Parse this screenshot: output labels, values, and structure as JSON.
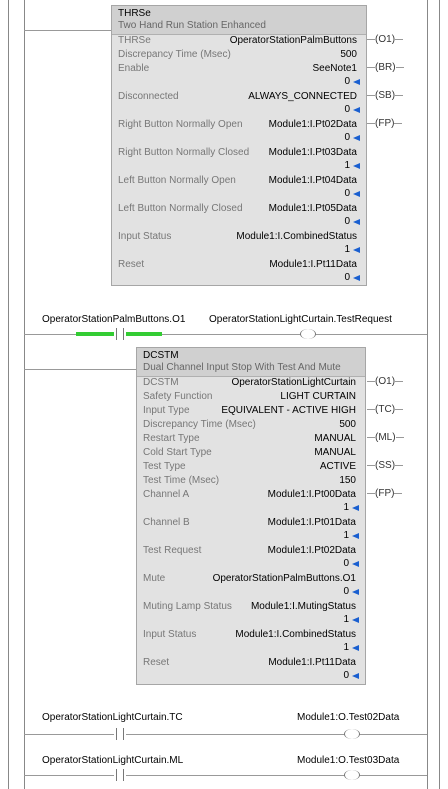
{
  "thrse": {
    "title": "THRSe",
    "subtitle": "Two Hand Run Station Enhanced",
    "rows": [
      {
        "label": "THRSe",
        "value": "OperatorStationPalmButtons"
      },
      {
        "label": "Discrepancy Time (Msec)",
        "value": "500"
      },
      {
        "label": "Enable",
        "value": "SeeNote1"
      },
      {
        "label": "Disconnected",
        "value": "ALWAYS_CONNECTED"
      },
      {
        "label": "Right Button Normally Open",
        "value": "Module1:I.Pt02Data"
      },
      {
        "label": "Right Button Normally Closed",
        "value": "Module1:I.Pt03Data"
      },
      {
        "label": "Left Button Normally Open",
        "value": "Module1:I.Pt04Data"
      },
      {
        "label": "Left Button Normally Closed",
        "value": "Module1:I.Pt05Data"
      },
      {
        "label": "Input Status",
        "value": "Module1:I.CombinedStatus"
      },
      {
        "label": "Reset",
        "value": "Module1:I.Pt11Data"
      }
    ],
    "values": [
      "0",
      "0",
      "0",
      "1",
      "0",
      "0",
      "1",
      "0"
    ],
    "outputs": [
      "O1",
      "BR",
      "SB",
      "FP"
    ]
  },
  "rung2": {
    "contact_tag": "OperatorStationPalmButtons.O1",
    "coil_tag": "OperatorStationLightCurtain.TestRequest"
  },
  "dcstm": {
    "title": "DCSTM",
    "subtitle": "Dual Channel Input Stop With Test And Mute",
    "rows": [
      {
        "label": "DCSTM",
        "value": "OperatorStationLightCurtain"
      },
      {
        "label": "Safety Function",
        "value": "LIGHT CURTAIN"
      },
      {
        "label": "Input Type",
        "value": "EQUIVALENT - ACTIVE HIGH"
      },
      {
        "label": "Discrepancy Time (Msec)",
        "value": "500"
      },
      {
        "label": "Restart Type",
        "value": "MANUAL"
      },
      {
        "label": "Cold Start Type",
        "value": "MANUAL"
      },
      {
        "label": "Test Type",
        "value": "ACTIVE"
      },
      {
        "label": "Test Time (Msec)",
        "value": "150"
      },
      {
        "label": "Channel A",
        "value": "Module1:I.Pt00Data"
      },
      {
        "label": "Channel B",
        "value": "Module1:I.Pt01Data"
      },
      {
        "label": "Test Request",
        "value": "Module1:I.Pt02Data"
      },
      {
        "label": "Mute",
        "value": "OperatorStationPalmButtons.O1"
      },
      {
        "label": "Muting Lamp Status",
        "value": "Module1:I.MutingStatus"
      },
      {
        "label": "Input Status",
        "value": "Module1:I.CombinedStatus"
      },
      {
        "label": "Reset",
        "value": "Module1:I.Pt11Data"
      }
    ],
    "values": [
      "1",
      "1",
      "0",
      "0",
      "1",
      "1",
      "0"
    ],
    "outputs": [
      "O1",
      "TC",
      "ML",
      "SS",
      "FP"
    ]
  },
  "rung3": {
    "contact_tag": "OperatorStationLightCurtain.TC",
    "coil_tag": "Module1:O.Test02Data"
  },
  "rung4": {
    "contact_tag": "OperatorStationLightCurtain.ML",
    "coil_tag": "Module1:O.Test03Data"
  },
  "colors": {
    "live_power": "#33cc33",
    "value_arrow": "#1a5fd0"
  }
}
